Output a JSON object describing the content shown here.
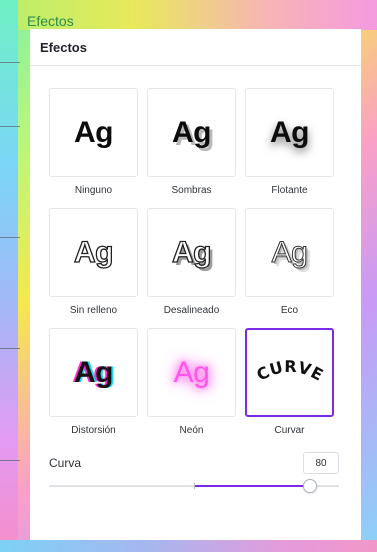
{
  "background_label": "Efectos",
  "panel": {
    "title": "Efectos",
    "effects": [
      {
        "label": "Ninguno",
        "sample": "Ag",
        "style": "plain"
      },
      {
        "label": "Sombras",
        "sample": "Ag",
        "style": "shadow"
      },
      {
        "label": "Flotante",
        "sample": "Ag",
        "style": "float"
      },
      {
        "label": "Sin relleno",
        "sample": "Ag",
        "style": "hollow"
      },
      {
        "label": "Desalineado",
        "sample": "Ag",
        "style": "offset"
      },
      {
        "label": "Eco",
        "sample": "Ag",
        "style": "echo"
      },
      {
        "label": "Distorsión",
        "sample": "Ag",
        "style": "distort"
      },
      {
        "label": "Neón",
        "sample": "Ag",
        "style": "neon"
      },
      {
        "label": "Curvar",
        "sample": "CURVE",
        "style": "curve",
        "selected": true
      }
    ],
    "curve": {
      "label": "Curva",
      "value": "80",
      "min": -100,
      "max": 100,
      "current": 80
    }
  },
  "colors": {
    "accent": "#7d2ae8",
    "neon": "#ff55ea",
    "distort_magenta": "#ff2ad3",
    "distort_cyan": "#19d8f2"
  }
}
